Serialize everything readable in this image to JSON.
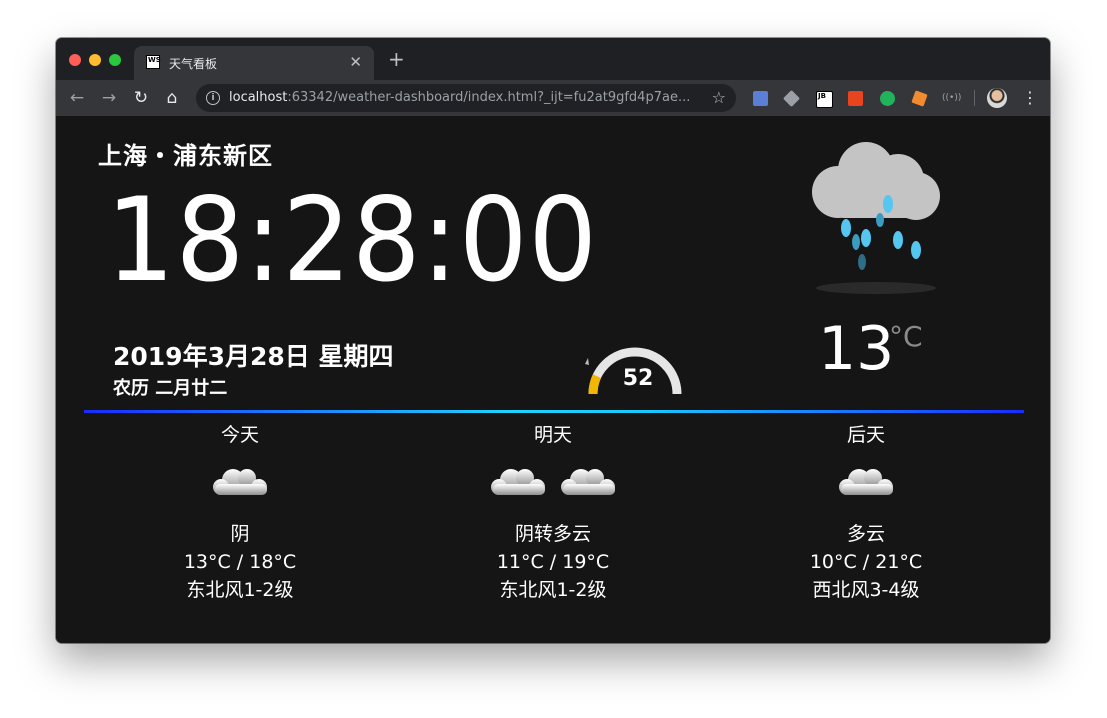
{
  "browser": {
    "tab_title": "天气看板",
    "tab_favicon": "WS",
    "url_host": "localhost",
    "url_rest": ":63342/weather-dashboard/index.html?_ijt=fu2at9gfd4p7ae...",
    "icons": [
      "back-icon",
      "forward-icon",
      "reload-icon",
      "home-icon",
      "info-icon",
      "star-icon",
      "menu-icon"
    ]
  },
  "dashboard": {
    "location": "上海・浦东新区",
    "time": "18:28:00",
    "date": "2019年3月28日 星期四",
    "lunar": "农历 二月廿二",
    "gauge": {
      "value": "52",
      "fill_fraction": 0.14,
      "color": "#f2b705"
    },
    "current_temp": "13",
    "temp_unit": "°C",
    "current_icon": "rain-cloud-icon"
  },
  "forecast": [
    {
      "day": "今天",
      "desc": "阴",
      "temp": "13°C / 18°C",
      "wind": "东北风1-2级",
      "icons": 1
    },
    {
      "day": "明天",
      "desc": "阴转多云",
      "temp": "11°C / 19°C",
      "wind": "东北风1-2级",
      "icons": 2
    },
    {
      "day": "后天",
      "desc": "多云",
      "temp": "10°C / 21°C",
      "wind": "西北风3-4级",
      "icons": 1
    }
  ],
  "colors": {
    "background": "#151515",
    "divider_start": "#1a2cff",
    "divider_mid": "#1fd3ff"
  }
}
